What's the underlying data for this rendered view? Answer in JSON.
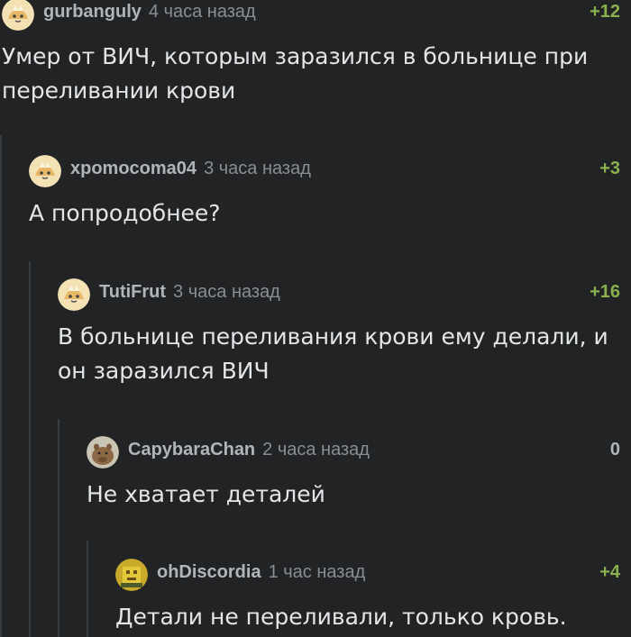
{
  "comments": [
    {
      "username": "gurbanguly",
      "time": "4 часа назад",
      "rating": "+12",
      "text": "Умер от ВИЧ, которым заразился в больнице при переливании крови",
      "avatar": "generic-avatar-icon"
    },
    {
      "username": "xpomocoma04",
      "time": "3 часа назад",
      "rating": "+3",
      "text": "А попродобнее?",
      "avatar": "generic-avatar-icon"
    },
    {
      "username": "TutiFrut",
      "time": "3 часа назад",
      "rating": "+16",
      "text": "В больнице переливания крови ему делали, и он заразился ВИЧ",
      "avatar": "generic-avatar-icon"
    },
    {
      "username": "CapybaraChan",
      "time": "2 часа назад",
      "rating": "0",
      "text": "Не хватает деталей",
      "avatar": "capybara-avatar-icon"
    },
    {
      "username": "ohDiscordia",
      "time": "1 час назад",
      "rating": "+4",
      "text": "Детали не переливали, только кровь.",
      "avatar": "yellow-avatar-icon"
    }
  ],
  "colors": {
    "background": "#212325",
    "thread_line": "#3a3d40",
    "username": "#b1b5b9",
    "timestamp": "#8a8e92",
    "rating_positive": "#8ab04f",
    "text": "#e3e5e7"
  }
}
